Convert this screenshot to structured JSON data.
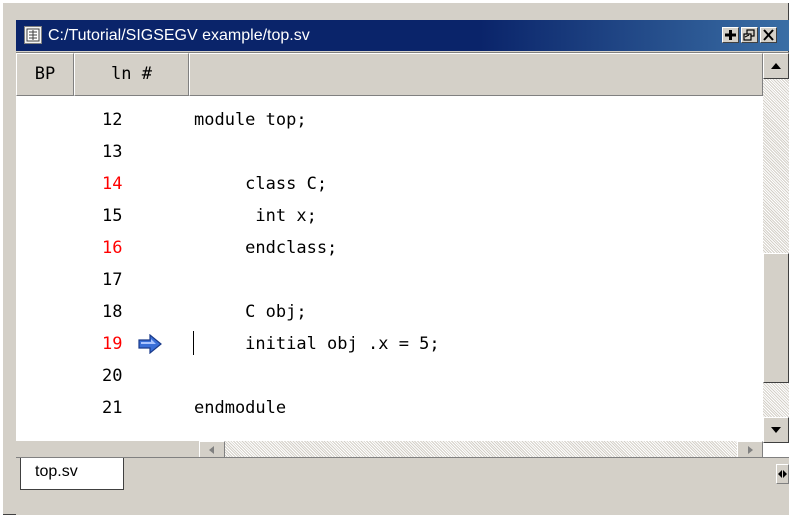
{
  "window": {
    "title": "C:/Tutorial/SIGSEGV example/top.sv",
    "buttons": {
      "add": "+",
      "restore": "restore",
      "close": "×"
    }
  },
  "header": {
    "bp_label": "BP",
    "ln_label": "ln #"
  },
  "lines": [
    {
      "num": "12",
      "code": "module top;",
      "breakpoint": false,
      "current": false
    },
    {
      "num": "13",
      "code": "",
      "breakpoint": false,
      "current": false
    },
    {
      "num": "14",
      "code": "     class C;",
      "breakpoint": true,
      "current": false
    },
    {
      "num": "15",
      "code": "      int x;",
      "breakpoint": false,
      "current": false
    },
    {
      "num": "16",
      "code": "     endclass;",
      "breakpoint": true,
      "current": false
    },
    {
      "num": "17",
      "code": "",
      "breakpoint": false,
      "current": false
    },
    {
      "num": "18",
      "code": "     C obj;",
      "breakpoint": false,
      "current": false
    },
    {
      "num": "19",
      "code": "     initial obj .x = 5;",
      "breakpoint": true,
      "current": true
    },
    {
      "num": "20",
      "code": "",
      "breakpoint": false,
      "current": false
    },
    {
      "num": "21",
      "code": "endmodule",
      "breakpoint": false,
      "current": false
    }
  ],
  "colors": {
    "breakpoint_line": "#ff0000",
    "arrow": "#3a6fd8",
    "titlebar": "#0a246a"
  },
  "tab": {
    "label": "top.sv"
  }
}
